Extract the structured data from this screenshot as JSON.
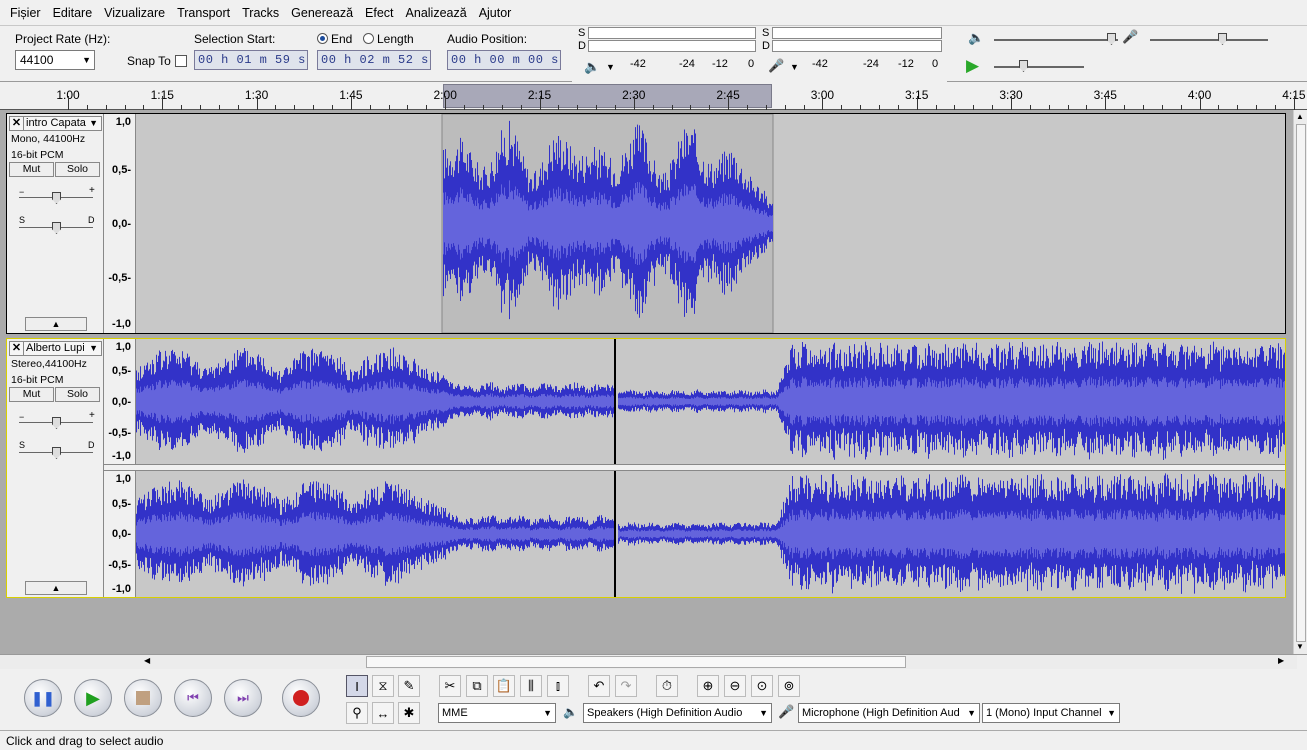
{
  "menu": [
    "Fișier",
    "Editare",
    "Vizualizare",
    "Transport",
    "Tracks",
    "Generează",
    "Efect",
    "Analizează",
    "Ajutor"
  ],
  "selection_bar": {
    "project_rate_label": "Project Rate (Hz):",
    "project_rate_value": "44100",
    "snap_to_label": "Snap To",
    "selection_start_label": "Selection Start:",
    "end_label": "End",
    "length_label": "Length",
    "selection_start_value": "00 h 01 m 59 s",
    "end_value": "00 h 02 m 52 s",
    "audio_position_label": "Audio Position:",
    "audio_position_value": "00 h 00 m 00 s"
  },
  "meters": {
    "left_channel": "S",
    "right_channel": "D",
    "scale": [
      "-42",
      "-24",
      "-12",
      "0"
    ]
  },
  "ruler": {
    "labels": [
      "1:00",
      "1:15",
      "1:30",
      "1:45",
      "2:00",
      "2:15",
      "2:30",
      "2:45",
      "3:00",
      "3:15",
      "3:30",
      "3:45",
      "4:00",
      "4:15"
    ]
  },
  "tracks": [
    {
      "name": "intro Capata",
      "info1": "Mono, 44100Hz",
      "info2": "16-bit PCM",
      "mute": "Mut",
      "solo": "Solo",
      "pan_left": "S",
      "pan_right": "D",
      "scale": [
        "1,0",
        "0,5-",
        "0,0-",
        "-0,5-",
        "-1,0"
      ]
    },
    {
      "name": "Alberto Lupi",
      "info1": "Stereo,44100Hz",
      "info2": "16-bit PCM",
      "mute": "Mut",
      "solo": "Solo",
      "pan_left": "S",
      "pan_right": "D",
      "scale": [
        "1,0",
        "0,5-",
        "0,0-",
        "-0,5-",
        "-1,0"
      ]
    }
  ],
  "devices": {
    "host": "MME",
    "output": "Speakers (High Definition Audio",
    "input": "Microphone (High Definition Aud",
    "channels": "1 (Mono) Input Channel"
  },
  "status": "Click and drag to select audio",
  "colors": {
    "wave": "#3232c8",
    "wave_rms": "#6464dc",
    "selection": "#a8a8b8"
  }
}
